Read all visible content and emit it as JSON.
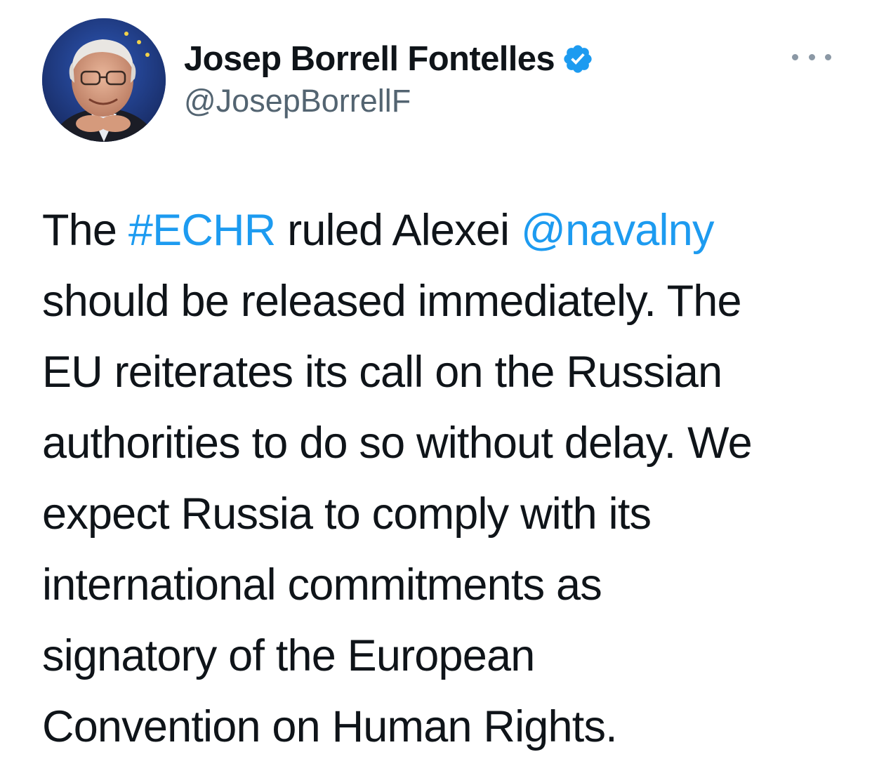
{
  "author": {
    "display_name": "Josep Borrell Fontelles",
    "handle": "@JosepBorrellF",
    "verified": true,
    "avatar_icon": "profile-photo"
  },
  "more_menu_icon": "more-horizontal-icon",
  "colors": {
    "link": "#1d9bf0",
    "text": "#0f1419",
    "secondary": "#536471",
    "verified_badge": "#1d9bf0"
  },
  "tweet": {
    "lines": [
      [
        {
          "text": "The ",
          "type": "text"
        },
        {
          "text": "#ECHR",
          "type": "hashtag"
        },
        {
          "text": " ruled Alexei ",
          "type": "text"
        },
        {
          "text": "@navalny",
          "type": "mention"
        }
      ],
      [
        {
          "text": "should be released immediately. The",
          "type": "text"
        }
      ],
      [
        {
          "text": "EU reiterates its call on the Russian",
          "type": "text"
        }
      ],
      [
        {
          "text": "authorities to do so without delay. We",
          "type": "text"
        }
      ],
      [
        {
          "text": "expect Russia to comply with its",
          "type": "text"
        }
      ],
      [
        {
          "text": "international commitments as",
          "type": "text"
        }
      ],
      [
        {
          "text": "signatory of the European",
          "type": "text"
        }
      ],
      [
        {
          "text": "Convention on Human Rights.",
          "type": "text"
        }
      ]
    ]
  }
}
